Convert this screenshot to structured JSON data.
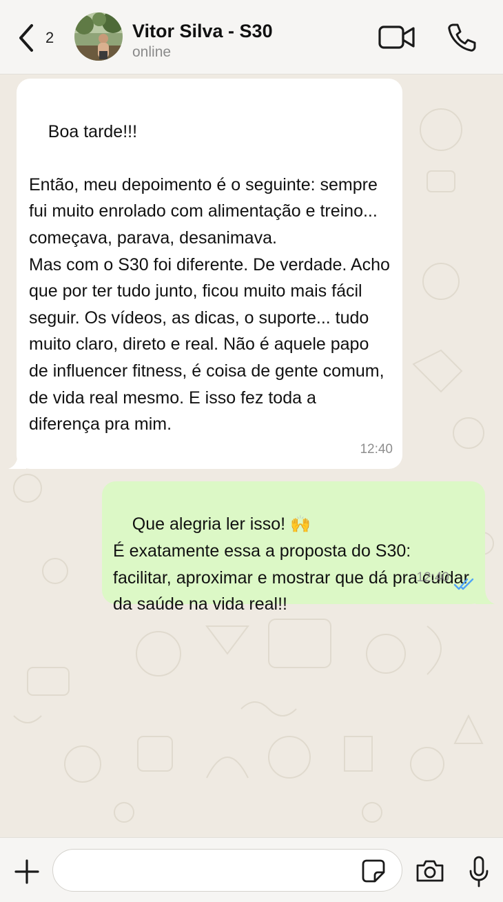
{
  "header": {
    "back_count": "2",
    "contact_name": "Vitor Silva - S30",
    "status": "online",
    "icons": [
      "chevron-left-icon",
      "video-call-icon",
      "phone-icon"
    ]
  },
  "messages": [
    {
      "direction": "incoming",
      "text": "Boa tarde!!!\n\nEntão, meu depoimento é o seguinte: sempre fui muito enrolado com alimentação e treino... começava, parava, desanimava.\nMas com o S30 foi diferente. De verdade. Acho que por ter tudo junto, ficou muito mais fácil seguir. Os vídeos, as dicas, o suporte... tudo muito claro, direto e real. Não é aquele papo de influencer fitness, é coisa de gente comum, de vida real mesmo. E isso fez toda a diferença pra mim.",
      "time": "12:40"
    },
    {
      "direction": "outgoing",
      "text_line1": "Que alegria ler isso! ",
      "emoji": "🙌",
      "text_rest": "\nÉ exatamente essa a proposta do S30: facilitar, aproximar e mostrar que dá pra cuidar da saúde na vida real!!",
      "time": "12:40",
      "status": "read"
    }
  ],
  "input": {
    "placeholder": "",
    "icons": [
      "plus-icon",
      "sticker-icon",
      "camera-icon",
      "microphone-icon"
    ]
  },
  "colors": {
    "header_bg": "#f6f5f3",
    "chat_bg": "#efeae2",
    "incoming_bubble": "#ffffff",
    "outgoing_bubble": "#dcf8c6",
    "read_ticks": "#4fa3f7"
  }
}
